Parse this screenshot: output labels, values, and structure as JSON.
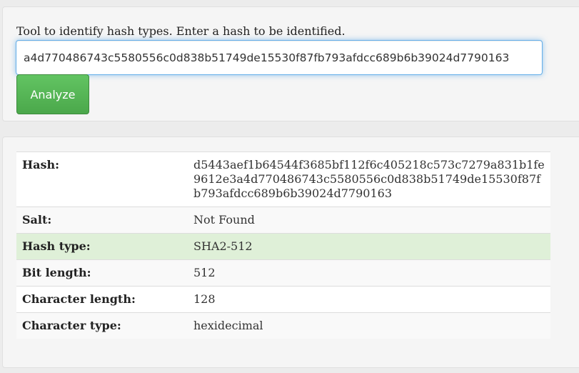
{
  "form": {
    "intro_text": "Tool to identify hash types. Enter a hash to be identified.",
    "hash_input_value": "a4d770486743c5580556c0d838b51749de15530f87fb793afdcc689b6b39024d7790163",
    "analyze_label": "Analyze"
  },
  "results": {
    "rows": [
      {
        "label": "Hash:",
        "value": "d5443aef1b64544f3685bf112f6c405218c573c7279a831b1fe9612e3a4d770486743c5580556c0d838b51749de15530f87fb793afdcc689b6b39024d7790163"
      },
      {
        "label": "Salt:",
        "value": "Not Found"
      },
      {
        "label": "Hash type:",
        "value": "SHA2-512"
      },
      {
        "label": "Bit length:",
        "value": "512"
      },
      {
        "label": "Character length:",
        "value": "128"
      },
      {
        "label": "Character type:",
        "value": "hexidecimal"
      }
    ]
  },
  "colors": {
    "highlight_row": "#dff0d8",
    "button_green": "#5cb85c",
    "input_focus_border": "#66afe9"
  }
}
